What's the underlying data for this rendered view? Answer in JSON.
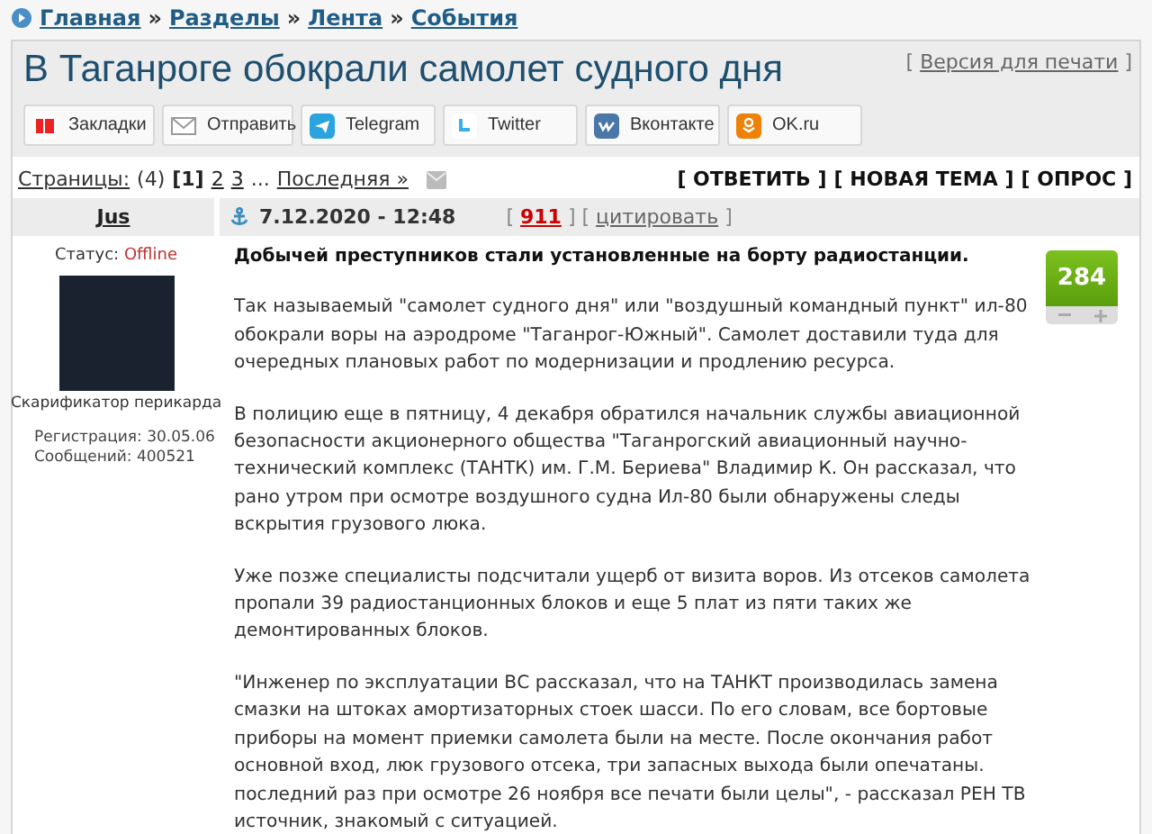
{
  "breadcrumb": [
    {
      "label": "Главная"
    },
    {
      "separator": "»",
      "label": "Разделы"
    },
    {
      "separator": "»",
      "label": "Лента"
    },
    {
      "separator": "»",
      "label": "События"
    }
  ],
  "title": "В Таганроге обокрали самолет судного дня",
  "print_link": {
    "open": "[",
    "label": "Версия для печати",
    "close": "]"
  },
  "share_buttons": [
    {
      "kind": "yandex",
      "label": "Закладки"
    },
    {
      "kind": "mail",
      "label": "Отправить"
    },
    {
      "kind": "telegram",
      "label": "Telegram"
    },
    {
      "kind": "twitter",
      "label": "Twitter"
    },
    {
      "kind": "vk",
      "label": "Вконтакте"
    },
    {
      "kind": "ok",
      "label": "OK.ru"
    }
  ],
  "pagination": {
    "label": "Страницы:",
    "count": "(4)",
    "pages": [
      {
        "label": "[1]",
        "selected": true
      },
      {
        "label": "2",
        "selected": false
      },
      {
        "label": "3",
        "selected": false
      }
    ],
    "ellipsis": "...",
    "last": "Последняя »"
  },
  "actions": [
    "[ ОТВЕТИТЬ ]",
    "[ НОВАЯ ТЕМА ]",
    "[ ОПРОС ]"
  ],
  "post": {
    "author": "Jus",
    "date": "7.12.2020 - 12:48",
    "number_open": "[",
    "number": "911",
    "number_close": "]",
    "quote_open": "[",
    "quote": "цитировать",
    "quote_close": "]",
    "status_label": "Статус:",
    "status": "Offline",
    "user_title": "Скарификатор перикарда",
    "stats": [
      "Регистрация: 30.05.06",
      "Сообщений: 400521"
    ],
    "rating": "284",
    "lead": "Добычей преступников стали установленные на борту радиостанции.",
    "paragraphs": [
      "Так называемый \"самолет судного дня\" или \"воздушный командный пункт\" ил-80 обокрали воры на аэродроме \"Таганрог-Южный\". Самолет доставили туда для очередных плановых работ по модернизации и продлению ресурса.",
      "В полицию еще в пятницу, 4 декабря обратился начальник службы авиационной безопасности акционерного общества \"Таганрогский авиационный научно-технический комплекс (ТАНТК) им. Г.М. Бериева\" Владимир К. Он рассказал, что рано утром при осмотре воздушного судна Ил-80 были обнаружены следы вскрытия грузового люка.",
      "Уже позже специалисты подсчитали ущерб от визита воров. Из отсеков самолета пропали 39 радиостанционных блоков и еще 5 плат из пяти таких же демонтированных блоков.",
      "\"Инженер по эксплуатации ВС рассказал, что на ТАНКТ производилась замена смазки на штоках амортизаторных стоек шасси. По его словам, все бортовые приборы на момент приемки самолета были на месте. После окончания работ основной вход, люк грузового отсека, три запасных выхода были опечатаны. последний раз при осмотре 26 ноября все печати были целы\", - рассказал РЕН ТВ источник, знакомый с ситуацией."
    ]
  }
}
